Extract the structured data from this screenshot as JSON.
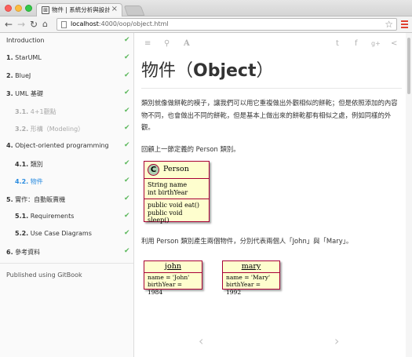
{
  "window": {
    "tab_title": "物件 | 系統分析與設計",
    "tab_close": "×",
    "favicon_glyph": "⊞"
  },
  "toolbar": {
    "back_icon": "←",
    "forward_icon": "→",
    "reload_icon": "↻",
    "home_icon": "⌂",
    "url_host": "localhost",
    "url_path": ":4000/oop/object.html",
    "star_icon": "☆"
  },
  "sidebar": {
    "items": [
      {
        "num": "",
        "label": "Introduction",
        "level": 1,
        "done": true
      },
      {
        "num": "1.",
        "label": "StarUML",
        "level": 1,
        "done": true
      },
      {
        "num": "2.",
        "label": "BlueJ",
        "level": 1,
        "done": true
      },
      {
        "num": "3.",
        "label": "UML 基礎",
        "level": 1,
        "done": true
      },
      {
        "num": "3.1.",
        "label": "4+1觀點",
        "level": 2,
        "done": true,
        "muted": true
      },
      {
        "num": "3.2.",
        "label": "形構（Modeling）",
        "level": 2,
        "done": true,
        "muted": true
      },
      {
        "num": "4.",
        "label": "Object-oriented programming",
        "level": 1,
        "done": true
      },
      {
        "num": "4.1.",
        "label": "類別",
        "level": 2,
        "done": true
      },
      {
        "num": "4.2.",
        "label": "物件",
        "level": 2,
        "done": true,
        "active": true
      },
      {
        "num": "5.",
        "label": "實作：自動販賣機",
        "level": 1,
        "done": true
      },
      {
        "num": "5.1.",
        "label": "Requirements",
        "level": 2,
        "done": true
      },
      {
        "num": "5.2.",
        "label": "Use Case Diagrams",
        "level": 2,
        "done": true
      },
      {
        "num": "6.",
        "label": "參考資料",
        "level": 1,
        "done": true
      }
    ],
    "check_glyph": "✔",
    "footer": "Published using GitBook"
  },
  "header_icons": {
    "menu": "≡",
    "search": "⚲",
    "font": "A",
    "twitter": "t",
    "facebook": "f",
    "google": "g+",
    "share": "<"
  },
  "page": {
    "title_prefix": "物件（",
    "title_bold": "Object",
    "title_suffix": "）",
    "para1": "類別就像做餅乾的模子，讓我們可以用它重複做出外觀相似的餅乾；但是依照添加的內容物不同，也會做出不同的餅乾，但是基本上做出來的餅乾都有相似之處，例如同樣的外觀。",
    "para2": "回顧上一節定義的 Person 類別。",
    "para3": "利用 Person 類別產生兩個物件，分別代表兩個人「John」與「Mary」。"
  },
  "uml_class": {
    "badge": "C",
    "name": "Person",
    "attributes": [
      "String name",
      "int birthYear"
    ],
    "methods": [
      "public void eat()",
      "public void sleep()"
    ]
  },
  "uml_objects": [
    {
      "name": "john",
      "fields": [
        "name = 'John'",
        "birthYear = 1984"
      ]
    },
    {
      "name": "mary",
      "fields": [
        "name = 'Mary'",
        "birthYear = 1992"
      ]
    }
  ],
  "pager": {
    "prev": "‹",
    "next": "›"
  },
  "colors": {
    "check": "#5cb85c",
    "active_link": "#2a8ce0",
    "uml_fill": "#fefece",
    "uml_border": "#a80036",
    "class_badge": "#add1b2"
  }
}
